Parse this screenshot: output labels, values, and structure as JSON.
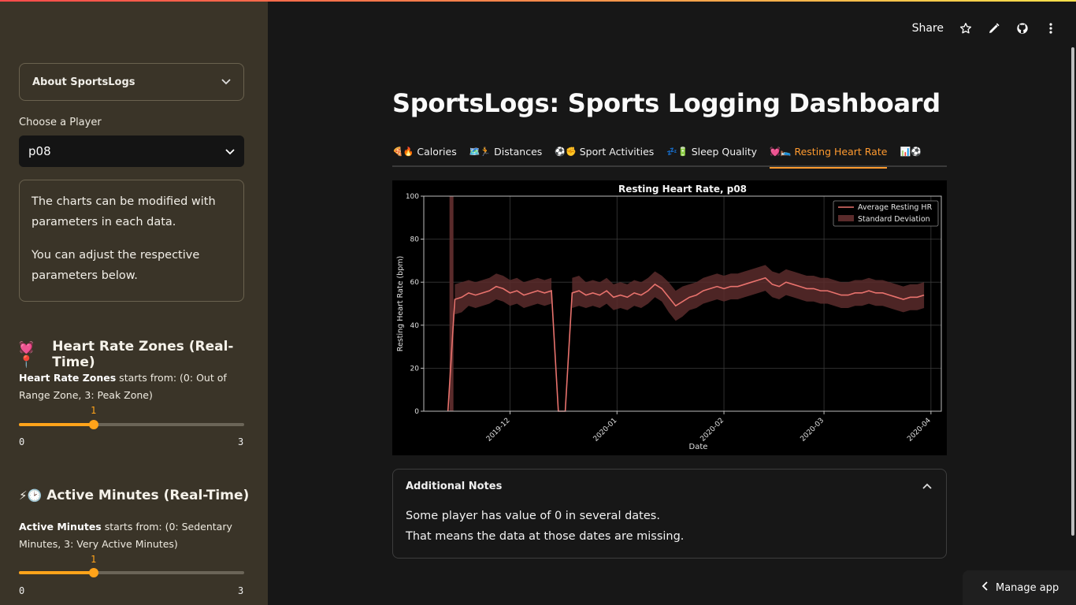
{
  "header": {
    "share_label": "Share",
    "icons": [
      "star-icon",
      "pencil-icon",
      "github-icon",
      "kebab-menu-icon"
    ]
  },
  "sidebar": {
    "expander_label": "About SportsLogs",
    "choose_label": "Choose a Player",
    "player_selected": "p08",
    "info_p1": "The charts can be modified with parameters in each data.",
    "info_p2": "You can adjust the respective parameters below.",
    "hr_zones": {
      "heading": "Heart Rate Zones (Real-Time)",
      "emoji": "💓📍",
      "desc_bold": "Heart Rate Zones",
      "desc_rest": " starts from: (0: Out of Range Zone, 3: Peak Zone)",
      "value": "1",
      "min": "0",
      "max": "3",
      "fraction": 0.333
    },
    "active_minutes": {
      "heading": "Active Minutes (Real-Time)",
      "emoji": "⚡🕑",
      "desc_bold": "Active Minutes",
      "desc_rest": " starts from: (0: Sedentary Minutes, 3: Very Active Minutes)",
      "value": "1",
      "min": "0",
      "max": "3",
      "fraction": 0.333
    }
  },
  "main": {
    "title": "SportsLogs: Sports Logging Dashboard",
    "tabs": [
      {
        "emoji": "🍕🔥",
        "label": "Calories",
        "active": false
      },
      {
        "emoji": "🗺️🏃",
        "label": "Distances",
        "active": false
      },
      {
        "emoji": "⚽✊",
        "label": "Sport Activities",
        "active": false
      },
      {
        "emoji": "💤🔋",
        "label": "Sleep Quality",
        "active": false
      },
      {
        "emoji": "💓🛌",
        "label": "Resting Heart Rate",
        "active": true
      },
      {
        "emoji": "📊⚽",
        "label": "",
        "active": false
      }
    ],
    "notes": {
      "heading": "Additional Notes",
      "line1": "Some player has value of 0 in several dates.",
      "line2": "That means the data at those dates are missing."
    }
  },
  "manage_app_label": "Manage app",
  "chart_data": {
    "type": "line",
    "title": "Resting Heart Rate, p08",
    "xlabel": "Date",
    "ylabel": "Resting Heart Rate (bpm)",
    "ylim": [
      0,
      100
    ],
    "yticks": [
      0,
      20,
      40,
      60,
      80,
      100
    ],
    "xticks": [
      "2019-12",
      "2020-01",
      "2020-02",
      "2020-03",
      "2020-04"
    ],
    "grid": true,
    "legend_position": "top-right",
    "colors": {
      "line": "#e8726d",
      "band": "#5a2b2b"
    },
    "series": [
      {
        "name": "Average Resting HR",
        "x": [
          "2019-11-13",
          "2019-11-15",
          "2019-11-17",
          "2019-11-19",
          "2019-11-21",
          "2019-11-23",
          "2019-11-25",
          "2019-11-27",
          "2019-11-29",
          "2019-12-01",
          "2019-12-03",
          "2019-12-05",
          "2019-12-07",
          "2019-12-09",
          "2019-12-11",
          "2019-12-13",
          "2019-12-15",
          "2019-12-17",
          "2019-12-19",
          "2019-12-21",
          "2019-12-23",
          "2019-12-25",
          "2019-12-27",
          "2019-12-29",
          "2019-12-31",
          "2020-01-02",
          "2020-01-04",
          "2020-01-06",
          "2020-01-08",
          "2020-01-10",
          "2020-01-12",
          "2020-01-14",
          "2020-01-16",
          "2020-01-18",
          "2020-01-20",
          "2020-01-22",
          "2020-01-24",
          "2020-01-26",
          "2020-01-28",
          "2020-01-30",
          "2020-02-01",
          "2020-02-03",
          "2020-02-05",
          "2020-02-07",
          "2020-02-09",
          "2020-02-11",
          "2020-02-13",
          "2020-02-15",
          "2020-02-17",
          "2020-02-19",
          "2020-02-21",
          "2020-02-23",
          "2020-02-25",
          "2020-02-27",
          "2020-02-29",
          "2020-03-02",
          "2020-03-04",
          "2020-03-06",
          "2020-03-08",
          "2020-03-10",
          "2020-03-12",
          "2020-03-14",
          "2020-03-16",
          "2020-03-18",
          "2020-03-20",
          "2020-03-22",
          "2020-03-24",
          "2020-03-26",
          "2020-03-28",
          "2020-03-30"
        ],
        "values": [
          0,
          52,
          53,
          55,
          54,
          55,
          56,
          58,
          57,
          55,
          56,
          54,
          55,
          56,
          55,
          56,
          0,
          0,
          55,
          56,
          54,
          55,
          54,
          56,
          53,
          54,
          53,
          55,
          54,
          56,
          59,
          57,
          53,
          49,
          51,
          53,
          54,
          56,
          57,
          58,
          57,
          58,
          58,
          59,
          60,
          61,
          62,
          59,
          58,
          60,
          59,
          58,
          57,
          57,
          56,
          56,
          55,
          54,
          54,
          55,
          55,
          56,
          55,
          55,
          54,
          53,
          52,
          53,
          53,
          54
        ],
        "std": [
          0,
          7,
          7,
          6,
          6,
          6,
          6,
          6,
          6,
          6,
          6,
          6,
          6,
          6,
          6,
          6,
          0,
          0,
          7,
          7,
          6,
          6,
          6,
          6,
          6,
          6,
          6,
          6,
          6,
          6,
          6,
          6,
          7,
          7,
          7,
          6,
          6,
          6,
          6,
          6,
          6,
          6,
          6,
          6,
          6,
          6,
          6,
          6,
          6,
          6,
          6,
          6,
          6,
          6,
          6,
          6,
          6,
          6,
          6,
          6,
          6,
          6,
          6,
          6,
          6,
          6,
          6,
          6,
          6,
          6
        ]
      },
      {
        "name": "Standard Deviation"
      }
    ]
  }
}
